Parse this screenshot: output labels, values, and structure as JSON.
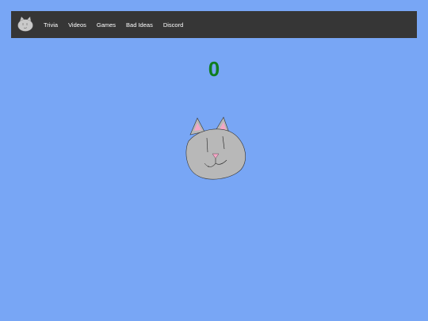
{
  "navbar": {
    "logo_icon": "cat-head-icon",
    "links": [
      {
        "label": "Trivia"
      },
      {
        "label": "Videos"
      },
      {
        "label": "Games"
      },
      {
        "label": "Bad Ideas"
      },
      {
        "label": "Discord"
      }
    ]
  },
  "game": {
    "score": "0",
    "cat_icon": "cat-head-icon"
  },
  "colors": {
    "background": "#78a6f5",
    "navbar": "#363636",
    "score": "#0f7d1f",
    "cat_fill": "#b8b8b8",
    "ear_inner": "#f4a6c6"
  }
}
